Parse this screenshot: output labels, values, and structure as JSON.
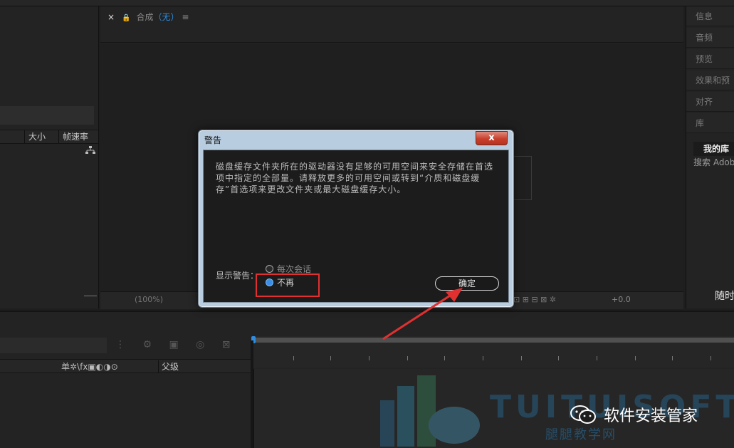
{
  "project_panel": {
    "columns": [
      "大小",
      "帧速率"
    ]
  },
  "comp_panel": {
    "tab_close": "×",
    "tab_prefix": "合成",
    "tab_value": "（无）",
    "tab_menu": "≡",
    "zoom": "(100%)",
    "exposure": "+0.0"
  },
  "right_panel": {
    "items": [
      "信息",
      "音频",
      "预览",
      "效果和预",
      "对齐",
      "库"
    ],
    "library_name": "我的库",
    "search_placeholder": "搜索 Adobe",
    "random_label": "随时"
  },
  "timeline": {
    "column_symbols": "单✲\\fx▣◐◑⊙",
    "parent_label": "父级"
  },
  "dialog": {
    "title": "警告",
    "close_glyph": "x",
    "message": "磁盘缓存文件夹所在的驱动器没有足够的可用空间来安全存储在首选项中指定的全部量。请释放更多的可用空间或转到“介质和磁盘缓存”首选项来更改文件夹或最大磁盘缓存大小。",
    "show_warning_label": "显示警告：",
    "option_each_session": "每次会话",
    "option_never": "不再",
    "selected_option": "不再",
    "ok_button": "确定"
  },
  "watermark": {
    "latin": "TUITUISOFT",
    "chinese": "腿腿教学网",
    "wechat_account": "软件安装管家"
  },
  "colors": {
    "accent_blue": "#2e8de0",
    "annotation_red": "#e03030",
    "dialog_frame": "#b9cde0"
  }
}
